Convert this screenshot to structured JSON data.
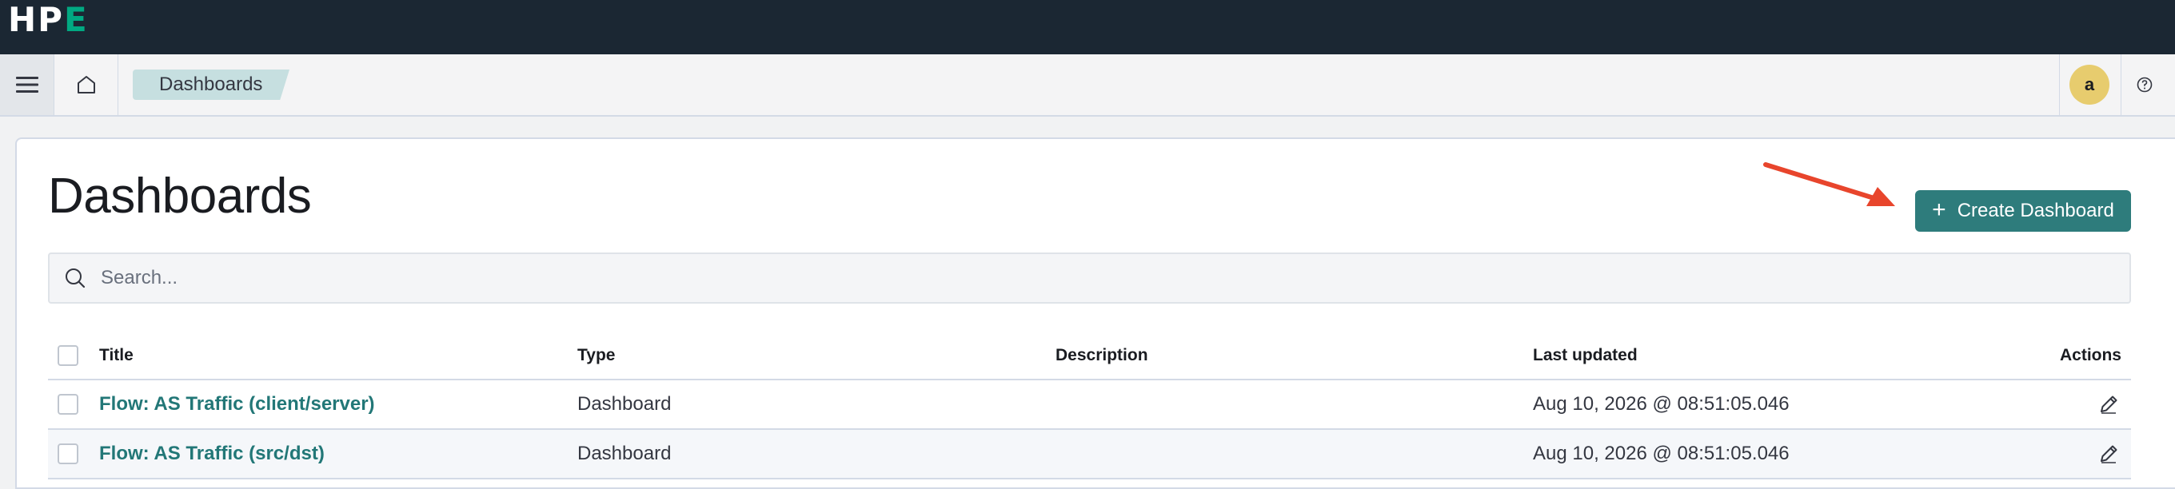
{
  "brand": {
    "logo_hp": "HP",
    "logo_e": "E"
  },
  "nav": {
    "breadcrumb": "Dashboards",
    "avatar_initial": "a"
  },
  "page": {
    "title": "Dashboards",
    "create_button": "Create Dashboard",
    "search_placeholder": "Search..."
  },
  "table": {
    "headers": {
      "title": "Title",
      "type": "Type",
      "description": "Description",
      "last_updated": "Last updated",
      "actions": "Actions"
    },
    "rows": [
      {
        "title": "Flow: AS Traffic (client/server)",
        "type": "Dashboard",
        "description": "",
        "last_updated": "Aug 10, 2026 @ 08:51:05.046"
      },
      {
        "title": "Flow: AS Traffic (src/dst)",
        "type": "Dashboard",
        "description": "",
        "last_updated": "Aug 10, 2026 @ 08:51:05.046"
      }
    ]
  },
  "colors": {
    "accent": "#2e7c7c",
    "link": "#227777",
    "annotation_arrow": "#e8452c",
    "topbar": "#1b2733"
  }
}
